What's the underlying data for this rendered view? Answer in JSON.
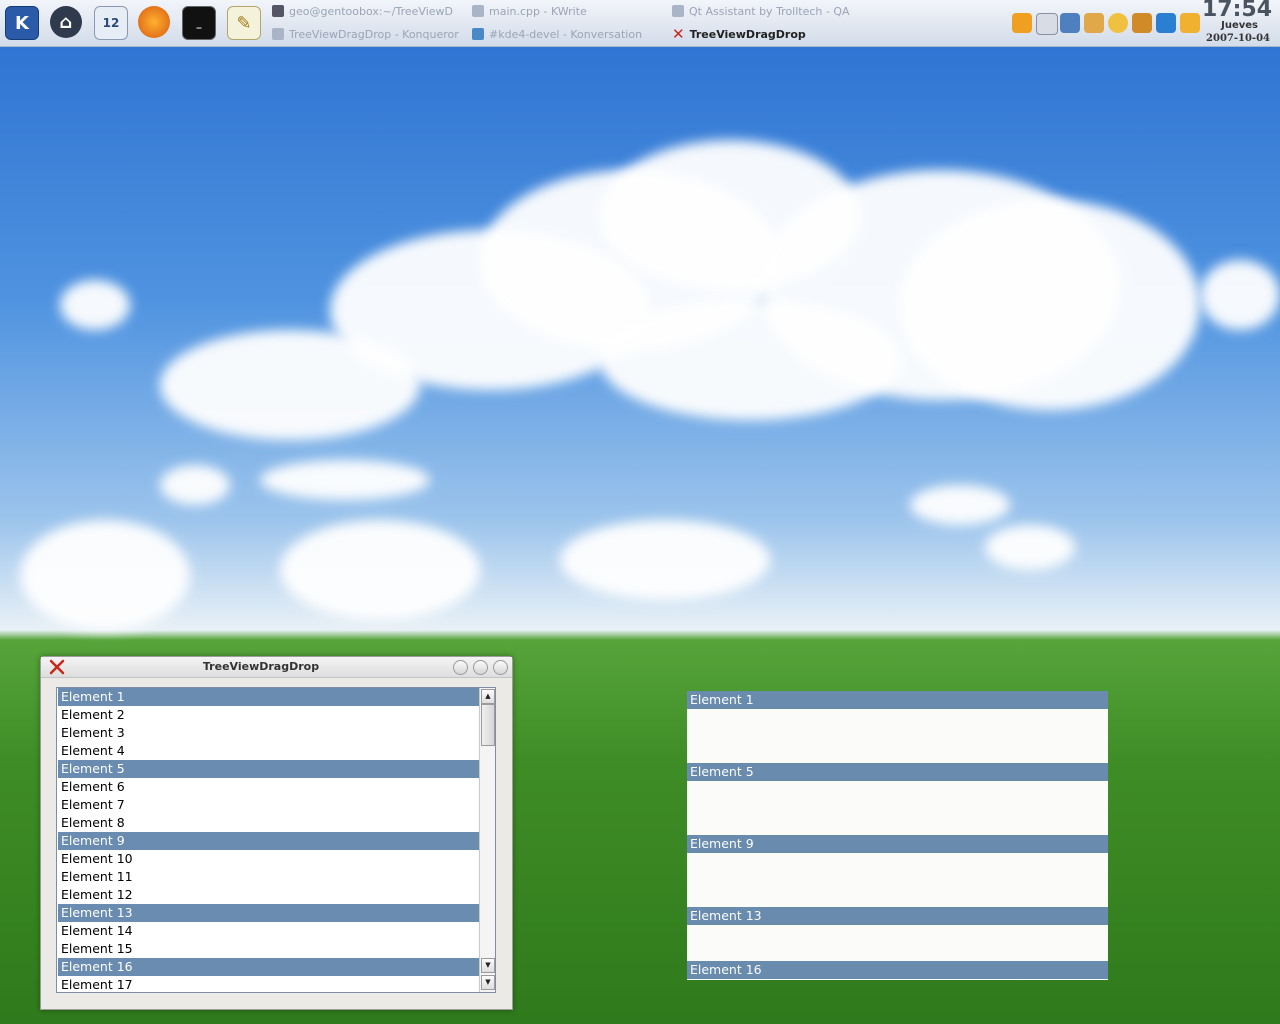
{
  "taskbar": {
    "launchers": [
      "kmenu-icon",
      "home-icon",
      "mail-calendar-icon",
      "firefox-icon",
      "terminal-icon",
      "text-editor-icon"
    ],
    "tasks": [
      {
        "label": "geo@gentoobox:~/TreeViewD",
        "icon": "terminal-icon"
      },
      {
        "label": "main.cpp - KWrite",
        "icon": "document-icon"
      },
      {
        "label": "Qt Assistant by Trolltech - QA",
        "icon": "assistant-icon"
      },
      {
        "label": "TreeViewDragDrop - Konqueror",
        "icon": "document-icon"
      },
      {
        "label": "#kde4-devel - Konversation",
        "icon": "chat-icon"
      },
      {
        "label": "TreeViewDragDrop",
        "icon": "app-x-icon"
      }
    ],
    "clock": {
      "time": "17:54",
      "day": "Jueves",
      "date": "2007-10-04"
    }
  },
  "window": {
    "title": "TreeViewDragDrop",
    "items": [
      {
        "label": "Element 1",
        "selected": true
      },
      {
        "label": "Element 2",
        "selected": false
      },
      {
        "label": "Element 3",
        "selected": false
      },
      {
        "label": "Element 4",
        "selected": false
      },
      {
        "label": "Element 5",
        "selected": true
      },
      {
        "label": "Element 6",
        "selected": false
      },
      {
        "label": "Element 7",
        "selected": false
      },
      {
        "label": "Element 8",
        "selected": false
      },
      {
        "label": "Element 9",
        "selected": true
      },
      {
        "label": "Element 10",
        "selected": false
      },
      {
        "label": "Element 11",
        "selected": false
      },
      {
        "label": "Element 12",
        "selected": false
      },
      {
        "label": "Element 13",
        "selected": true
      },
      {
        "label": "Element 14",
        "selected": false
      },
      {
        "label": "Element 15",
        "selected": false
      },
      {
        "label": "Element 16",
        "selected": true
      },
      {
        "label": "Element 17",
        "selected": false
      }
    ],
    "scroll_up": "▲",
    "scroll_down": "▼"
  },
  "drag_pixmap": {
    "items": [
      "Element 1",
      "Element 5",
      "Element 9",
      "Element 13",
      "Element 16"
    ]
  },
  "colors": {
    "selection": "#6a8cb1"
  }
}
